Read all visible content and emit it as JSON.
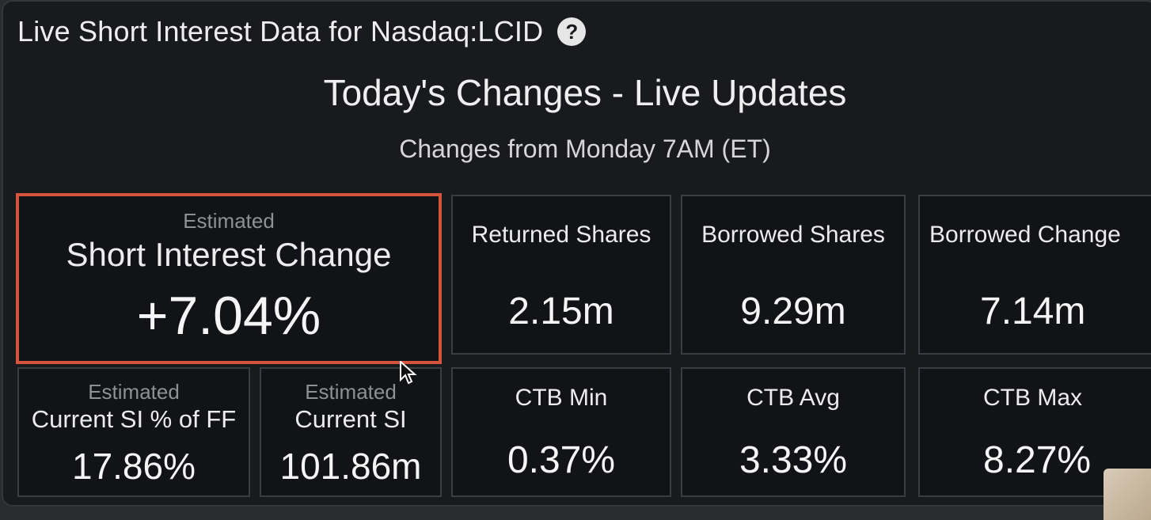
{
  "header": {
    "title": "Live Short Interest Data for Nasdaq:LCID",
    "help_icon": "question-circle-icon"
  },
  "subtitle": "Today's Changes - Live Updates",
  "changes_from": "Changes from Monday 7AM (ET)",
  "cards": {
    "si_change": {
      "estimated": "Estimated",
      "label": "Short Interest Change",
      "value": "+7.04%"
    },
    "returned_shares": {
      "label": "Returned Shares",
      "value": "2.15m"
    },
    "borrowed_shares": {
      "label": "Borrowed Shares",
      "value": "9.29m"
    },
    "borrowed_change": {
      "label": "Borrowed Change",
      "value": "7.14m"
    },
    "current_si_pct_ff": {
      "estimated": "Estimated",
      "label": "Current SI % of FF",
      "value": "17.86%"
    },
    "current_si": {
      "estimated": "Estimated",
      "label": "Current SI",
      "value": "101.86m"
    },
    "ctb_min": {
      "label": "CTB Min",
      "value": "0.37%"
    },
    "ctb_avg": {
      "label": "CTB Avg",
      "value": "3.33%"
    },
    "ctb_max": {
      "label": "CTB Max",
      "value": "8.27%"
    }
  },
  "colors": {
    "highlight_border": "#d6533d",
    "panel_bg": "#181a1d",
    "card_bg": "#111316"
  }
}
